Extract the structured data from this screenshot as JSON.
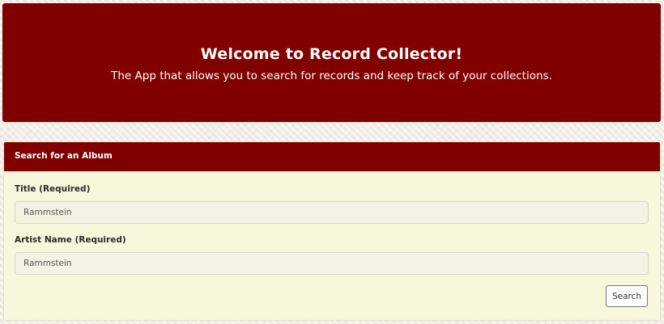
{
  "header": {
    "title": "Welcome to Record Collector!",
    "subtitle": "The App that allows you to search for records and keep track of your collections."
  },
  "search_panel": {
    "heading": "Search for an Album",
    "title_field": {
      "label": "Title (Required)",
      "value": "Rammstein"
    },
    "artist_field": {
      "label": "Artist Name (Required)",
      "value": "Rammstein"
    },
    "search_button": "Search"
  },
  "colors": {
    "brand": "#800000",
    "panel_body": "#f7f7dc",
    "page_background": "#f1ede6"
  }
}
